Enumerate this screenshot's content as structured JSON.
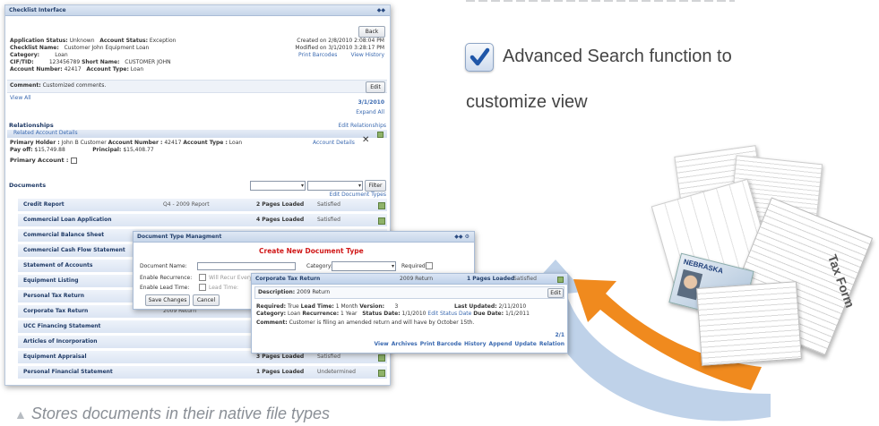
{
  "checklist": {
    "title": "Checklist Interface",
    "title_icons": "◆◆",
    "back_label": "Back",
    "info": {
      "application_status_label": "Application Status:",
      "application_status": "Unknown",
      "account_status_label": "Account Status:",
      "account_status": "Exception",
      "checklist_name_label": "Checklist Name:",
      "checklist_name": "Customer John Equipment Loan",
      "category_label": "Category:",
      "category": "Loan",
      "cif_label": "CIF/TID:",
      "cif": "123456789",
      "short_name_label": "Short Name:",
      "short_name": "CUSTOMER JOHN",
      "account_number_label": "Account Number:",
      "account_number": "42417",
      "account_type_label": "Account Type:",
      "account_type": "Loan",
      "created": "Created on 2/8/2010 2:08:04 PM",
      "modified": "Modified on 3/1/2010 3:28:17 PM",
      "print_barcodes": "Print Barcodes",
      "view_history": "View History"
    },
    "comment_label": "Comment:",
    "comment": "Customized comments.",
    "edit_label": "Edit",
    "view_all": "View All",
    "comment_date": "3/1/2010",
    "expand_all": "Expand All",
    "relationships": {
      "title": "Relationships",
      "edit_link": "Edit Relationships",
      "related_header": "Related Account Details",
      "primary_holder_label": "Primary Holder :",
      "primary_holder": "John B Customer",
      "account_number_label": "Account Number :",
      "account_number": "42417",
      "account_type_label": "Account Type :",
      "account_type": "Loan",
      "account_details": "Account Details",
      "close": "✕",
      "payoff_label": "Pay off:",
      "payoff": "$15,749.88",
      "principal_label": "Principal:",
      "principal": "$15,408.77",
      "primary_account_label": "Primary Account :"
    },
    "documents": {
      "title": "Documents",
      "filter_label": "Filter",
      "edit_types": "Edit Document Types",
      "rows": [
        {
          "name": "Credit Report",
          "year": "Q4 - 2009 Report",
          "pages": "2 Pages Loaded",
          "status": "Satisfied"
        },
        {
          "name": "Commercial Loan Application",
          "year": "",
          "pages": "4 Pages Loaded",
          "status": "Satisfied"
        },
        {
          "name": "Commercial Balance Sheet",
          "year": "",
          "pages": "",
          "status": ""
        },
        {
          "name": "Commercial Cash Flow Statement",
          "year": "",
          "pages": "",
          "status": ""
        },
        {
          "name": "Statement of Accounts",
          "year": "",
          "pages": "",
          "status": ""
        },
        {
          "name": "Equipment Listing",
          "year": "",
          "pages": "",
          "status": ""
        },
        {
          "name": "Personal Tax Return",
          "year": "",
          "pages": "",
          "status": ""
        },
        {
          "name": "Corporate Tax Return",
          "year": "2009 Return",
          "pages": "",
          "status": ""
        },
        {
          "name": "UCC Financing Statement",
          "year": "",
          "pages": "",
          "status": ""
        },
        {
          "name": "Articles of Incorporation",
          "year": "",
          "pages": "",
          "status": ""
        },
        {
          "name": "Equipment Appraisal",
          "year": "",
          "pages": "3 Pages Loaded",
          "status": "Satisfied"
        },
        {
          "name": "Personal Financial Statement",
          "year": "",
          "pages": "1 Pages Loaded",
          "status": "Undetermined"
        }
      ]
    }
  },
  "doctype": {
    "title": "Document Type Managment",
    "title_icons": "◆◆ ⚙",
    "heading": "Create New Document Type",
    "document_name_label": "Document Name:",
    "category_label": "Category:",
    "required_label": "Required:",
    "enable_recurrence_label": "Enable Recurrence:",
    "will_recur_label": "Will Recur Every",
    "enable_lead_time_label": "Enable Lead Time:",
    "lead_time_label": "Lead Time:",
    "save_label": "Save Changes",
    "cancel_label": "Cancel"
  },
  "corp": {
    "title": "Corporate Tax Return",
    "title_year": "2009 Return",
    "title_pages": "1 Pages Loaded",
    "title_status": "Satisfied",
    "description_label": "Description:",
    "description": "2009 Return",
    "edit_label": "Edit",
    "required_label": "Required:",
    "required": "True",
    "lead_time_label": "Lead Time:",
    "lead_time": "1 Month",
    "version_label": "Version:",
    "version": "3",
    "last_updated_label": "Last Updated:",
    "last_updated": "2/11/2010",
    "category_label": "Category:",
    "category": "Loan",
    "recurrence_label": "Recurrence:",
    "recurrence": "1 Year",
    "status_date_label": "Status Date:",
    "status_date": "1/1/2010",
    "edit_status_date": "Edit Status Date",
    "due_date_label": "Due Date:",
    "due_date": "1/1/2011",
    "comment_label": "Comment:",
    "comment": "Customer is filing an amended return and will have by October 15th.",
    "page_fragment": "2/1",
    "actions": [
      "View",
      "Archives",
      "Print Barcode",
      "History",
      "Append",
      "Update",
      "Relation"
    ]
  },
  "marketing": {
    "feature_line1": "Advanced Search function to",
    "feature_line2": "customize view",
    "caption": "Stores documents in their native file types",
    "caption_marker": "▲",
    "form_text": "Tax Form",
    "license_text": "NEBRASKA"
  },
  "colors": {
    "accent_blue": "#3a69b0",
    "heading_red": "#d01818",
    "arrow_orange": "#f08a1e",
    "arrow_blue": "#b9cde6"
  }
}
